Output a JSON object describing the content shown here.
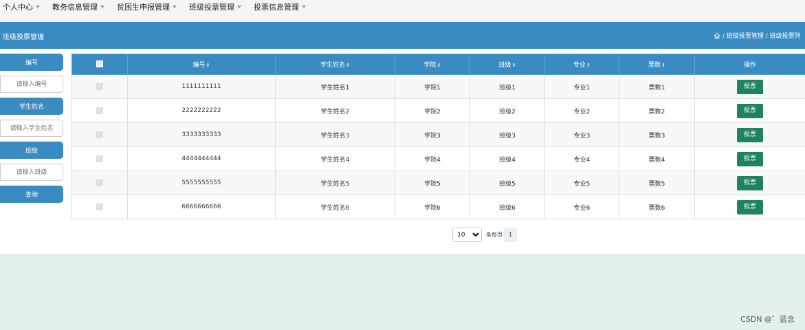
{
  "nav": {
    "items": [
      {
        "label": "个人中心"
      },
      {
        "label": "教务信息管理"
      },
      {
        "label": "贫困生申报管理"
      },
      {
        "label": "班级投票管理"
      },
      {
        "label": "投票信息管理"
      }
    ]
  },
  "banner": {
    "title": "班级投票管理",
    "breadcrumb": "/ 班级投票管理 / 班级投票列"
  },
  "search": {
    "field1_label": "编号",
    "field1_placeholder": "请输入编号",
    "field2_label": "学生姓名",
    "field2_placeholder": "请输入学生姓名",
    "field3_label": "班级",
    "field3_placeholder": "请输入班级",
    "query_label": "查询"
  },
  "table": {
    "headers": [
      "编号",
      "学生姓名",
      "学院",
      "班级",
      "专业",
      "票数",
      "操作"
    ],
    "sort_glyph": "⇕",
    "rows": [
      {
        "id": "1111111111",
        "name": "学生姓名1",
        "college": "学院1",
        "class": "班级1",
        "major": "专业1",
        "votes": "票数1",
        "action": "投票"
      },
      {
        "id": "2222222222",
        "name": "学生姓名2",
        "college": "学院2",
        "class": "班级2",
        "major": "专业2",
        "votes": "票数2",
        "action": "投票"
      },
      {
        "id": "3333333333",
        "name": "学生姓名3",
        "college": "学院3",
        "class": "班级3",
        "major": "专业3",
        "votes": "票数3",
        "action": "投票"
      },
      {
        "id": "4444444444",
        "name": "学生姓名4",
        "college": "学院4",
        "class": "班级4",
        "major": "专业4",
        "votes": "票数4",
        "action": "投票"
      },
      {
        "id": "5555555555",
        "name": "学生姓名5",
        "college": "学院5",
        "class": "班级5",
        "major": "专业5",
        "votes": "票数5",
        "action": "投票"
      },
      {
        "id": "6666666666",
        "name": "学生姓名6",
        "college": "学院6",
        "class": "班级6",
        "major": "专业6",
        "votes": "票数6",
        "action": "投票"
      }
    ]
  },
  "pager": {
    "page_size": "10",
    "per_page_label": "条每页",
    "current_page": "1"
  },
  "footer": {
    "watermark": "CSDN @゛蓝念"
  },
  "colors": {
    "primary": "#3a8bc1",
    "vote_button": "#1f8260",
    "footer_bg": "#e4f0ed"
  }
}
